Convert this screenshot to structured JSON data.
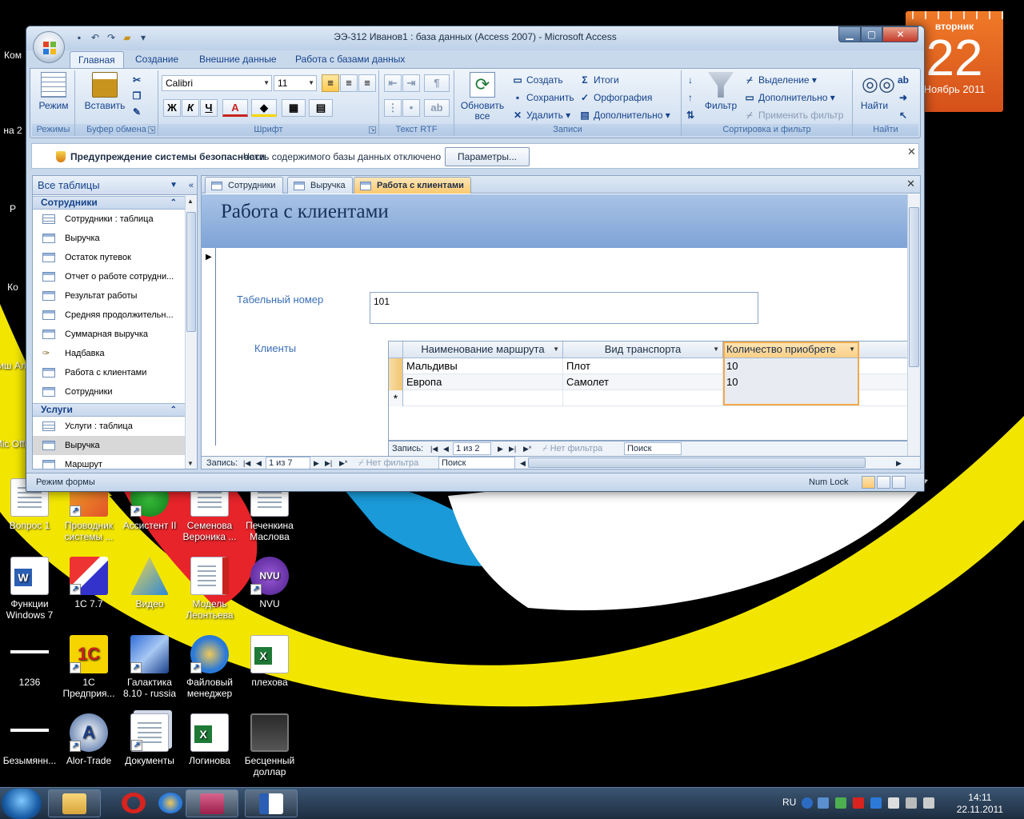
{
  "desktop": {
    "icons": [
      {
        "label": "Вопрос 1",
        "kind": "doc"
      },
      {
        "label": "Проводник системы ...",
        "kind": "app"
      },
      {
        "label": "Ассистент II",
        "kind": "app"
      },
      {
        "label": "Семенова Вероника ...",
        "kind": "doc"
      },
      {
        "label": "Печенкина Маслова",
        "kind": "doc"
      },
      {
        "label": "Функции Windows 7",
        "kind": "word"
      },
      {
        "label": "1С 7.7",
        "kind": "app"
      },
      {
        "label": "Видео",
        "kind": "app"
      },
      {
        "label": "Модель Леонтьева",
        "kind": "pdf"
      },
      {
        "label": "NVU",
        "kind": "app"
      },
      {
        "label": "1236",
        "kind": "img"
      },
      {
        "label": "1С Предприя...",
        "kind": "app"
      },
      {
        "label": "Галактика 8.10 - russia",
        "kind": "app"
      },
      {
        "label": "Файловый менеджер",
        "kind": "app"
      },
      {
        "label": "плехова",
        "kind": "xls"
      },
      {
        "label": "Безымянн...",
        "kind": "img"
      },
      {
        "label": "Alor-Trade",
        "kind": "app"
      },
      {
        "label": "Документы",
        "kind": "app"
      },
      {
        "label": "Логинова",
        "kind": "xls"
      },
      {
        "label": "Бесценный доллар",
        "kind": "video"
      }
    ],
    "partial_left_labels": [
      "Ком",
      "на 2",
      "Р",
      "Ко",
      "Шиш Алек",
      "Mic Offic"
    ]
  },
  "gadget": {
    "weekday": "вторник",
    "day": "22",
    "month_year": "Ноябрь 2011"
  },
  "taskbar": {
    "lang": "RU",
    "time": "14:11",
    "date": "22.11.2011"
  },
  "window": {
    "title": "ЭЭ-312 Иванов1 : база данных (Access 2007) - Microsoft Access",
    "controls": {
      "minimize": "▁",
      "maximize": "▢",
      "close": "✕"
    },
    "ribbon_tabs": [
      "Главная",
      "Создание",
      "Внешние данные",
      "Работа с базами данных"
    ],
    "active_ribbon_tab": "Главная",
    "ribbon": {
      "views": {
        "label": "Режим",
        "group": "Режимы"
      },
      "clipboard": {
        "paste": "Вставить",
        "group": "Буфер обмена"
      },
      "font": {
        "name": "Calibri",
        "size": "11",
        "group": "Шрифт",
        "bold": "Ж",
        "italic": "К",
        "underline": "Ч",
        "color": "А"
      },
      "rtf": {
        "group": "Текст RTF"
      },
      "records": {
        "refresh": "Обновить все",
        "create": "Создать",
        "save": "Сохранить",
        "delete": "Удалить",
        "totals": "Итоги",
        "spelling": "Орфография",
        "more": "Дополнительно",
        "group": "Записи"
      },
      "sort_filter": {
        "filter": "Фильтр",
        "selection": "Выделение",
        "advanced": "Дополнительно",
        "apply": "Применить фильтр",
        "group": "Сортировка и фильтр"
      },
      "find": {
        "find": "Найти",
        "group": "Найти"
      }
    },
    "security": {
      "title": "Предупреждение системы безопасности",
      "message": "Часть содержимого базы данных отключено",
      "button": "Параметры..."
    },
    "nav_pane": {
      "header": "Все таблицы",
      "groups": [
        {
          "name": "Сотрудники",
          "items": [
            {
              "label": "Сотрудники : таблица",
              "type": "table"
            },
            {
              "label": "Выручка",
              "type": "form"
            },
            {
              "label": "Остаток путевок",
              "type": "form"
            },
            {
              "label": "Отчет о работе сотрудни...",
              "type": "form"
            },
            {
              "label": "Результат работы",
              "type": "form"
            },
            {
              "label": "Средняя продолжительн...",
              "type": "form"
            },
            {
              "label": "Суммарная выручка",
              "type": "form"
            },
            {
              "label": "Надбавка",
              "type": "macro"
            },
            {
              "label": "Работа с клиентами",
              "type": "form"
            },
            {
              "label": "Сотрудники",
              "type": "form"
            }
          ]
        },
        {
          "name": "Услуги",
          "items": [
            {
              "label": "Услуги : таблица",
              "type": "table"
            },
            {
              "label": "Выручка",
              "type": "form",
              "selected": true
            },
            {
              "label": "Маршрут",
              "type": "form"
            }
          ]
        }
      ]
    },
    "doc_tabs": [
      {
        "label": "Сотрудники"
      },
      {
        "label": "Выручка"
      },
      {
        "label": "Работа с клиентами",
        "active": true
      }
    ],
    "form": {
      "title": "Работа с клиентами",
      "tabnum_label": "Табельный номер",
      "tabnum_value": "101",
      "clients_label": "Клиенты",
      "subform": {
        "columns": [
          "Наименование маршрута",
          "Вид транспорта",
          "Количество приобрете"
        ],
        "rows": [
          [
            "Мальдивы",
            "Плот",
            "10"
          ],
          [
            "Европа",
            "Самолет",
            "10"
          ]
        ],
        "nav": {
          "record_label": "Запись:",
          "position": "1 из 2",
          "filter": "Нет фильтра",
          "search": "Поиск"
        }
      },
      "nav": {
        "record_label": "Запись:",
        "position": "1 из 7",
        "filter": "Нет фильтра",
        "search": "Поиск"
      }
    },
    "status": {
      "mode": "Режим формы",
      "numlock": "Num Lock"
    }
  }
}
